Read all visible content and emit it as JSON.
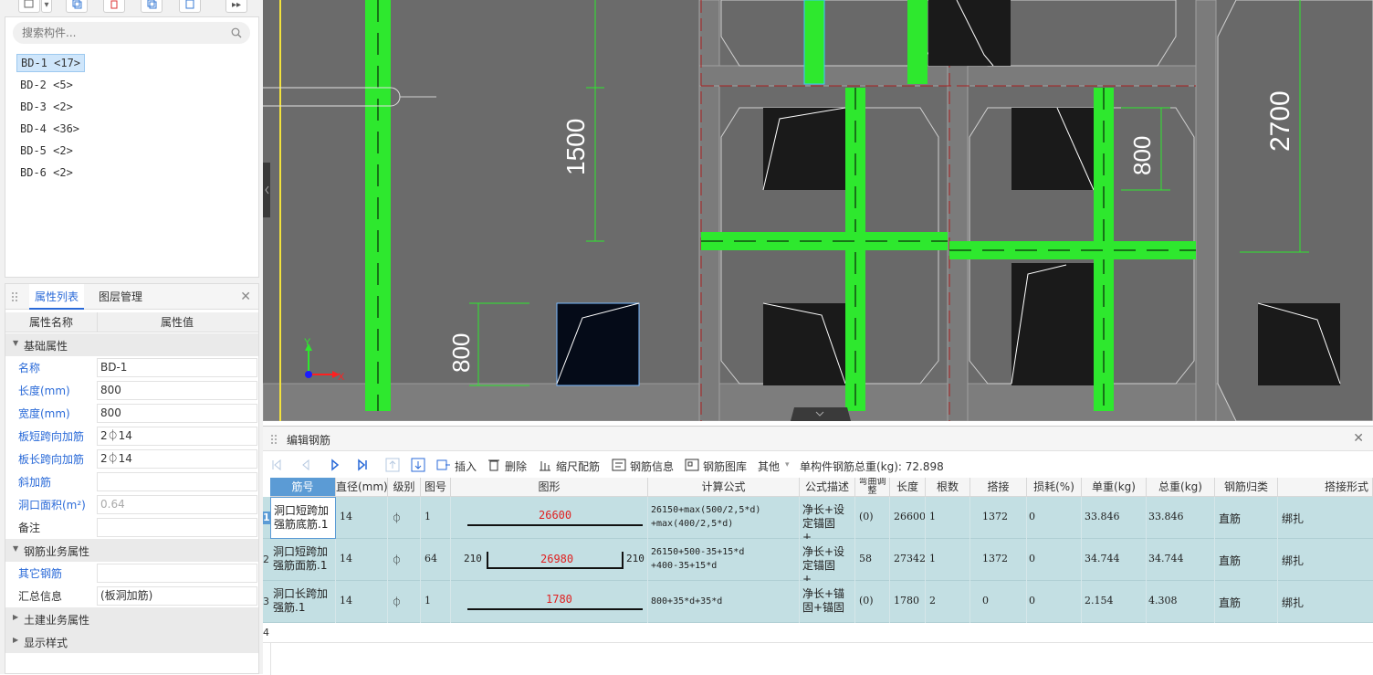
{
  "component_list": {
    "search_placeholder": "搜索构件...",
    "items": [
      {
        "label": "BD-1 <17>",
        "selected": true
      },
      {
        "label": "BD-2 <5>"
      },
      {
        "label": "BD-3 <2>"
      },
      {
        "label": "BD-4 <36>"
      },
      {
        "label": "BD-5 <2>"
      },
      {
        "label": "BD-6 <2>"
      }
    ]
  },
  "properties": {
    "tabs": [
      "属性列表",
      "图层管理"
    ],
    "header": {
      "name": "属性名称",
      "value": "属性值"
    },
    "groups": {
      "basic": "基础属性",
      "rebar_business": "钢筋业务属性",
      "civil_business": "土建业务属性",
      "display_style": "显示样式"
    },
    "rows": [
      {
        "name": "名称",
        "value": "BD-1"
      },
      {
        "name": "长度(mm)",
        "value": "800"
      },
      {
        "name": "宽度(mm)",
        "value": "800"
      },
      {
        "name": "板短跨向加筋",
        "value": "2⏀14"
      },
      {
        "name": "板长跨向加筋",
        "value": "2⏀14"
      },
      {
        "name": "斜加筋",
        "value": ""
      },
      {
        "name": "洞口面积(m²)",
        "value": "0.64"
      },
      {
        "name": "备注",
        "value": ""
      },
      {
        "name": "其它钢筋",
        "value": ""
      },
      {
        "name": "汇总信息",
        "value": "(板洞加筋)"
      }
    ]
  },
  "canvas": {
    "dimensions": [
      "1500",
      "800",
      "800",
      "2700"
    ],
    "axis_x": "X",
    "axis_y": "Y"
  },
  "editor": {
    "title": "编辑钢筋",
    "tools": {
      "insert": "插入",
      "delete": "删除",
      "scale": "缩尺配筋",
      "info": "钢筋信息",
      "library": "钢筋图库",
      "other": "其他",
      "total": "单构件钢筋总重(kg): 72.898"
    },
    "columns": [
      "筋号",
      "直径(mm)",
      "级别",
      "图号",
      "图形",
      "计算公式",
      "公式描述",
      "弯曲调整",
      "长度",
      "根数",
      "搭接",
      "损耗(%)",
      "单重(kg)",
      "总重(kg)",
      "钢筋归类",
      "搭接形式"
    ],
    "rows": [
      {
        "no": "1",
        "name": "洞口短跨加强筋底筋.1",
        "diameter": "14",
        "grade": "⏀",
        "shape_no": "1",
        "shape_value": "26600",
        "shape_left": "",
        "shape_right": "",
        "formula": "26150+max(500/2,5*d)\n+max(400/2,5*d)",
        "desc": "净长+设定锚固+…",
        "bend": "(0)",
        "length": "26600",
        "count": "1",
        "lap": "1372",
        "loss": "0",
        "unit_weight": "33.846",
        "total_weight": "33.846",
        "category": "直筋",
        "lap_type": "绑扎"
      },
      {
        "no": "2",
        "name": "洞口短跨加强筋面筋.1",
        "diameter": "14",
        "grade": "⏀",
        "shape_no": "64",
        "shape_value": "26980",
        "shape_left": "210",
        "shape_right": "210",
        "formula": "26150+500-35+15*d\n+400-35+15*d",
        "desc": "净长+设定锚固+…",
        "bend": "58",
        "length": "27342",
        "count": "1",
        "lap": "1372",
        "loss": "0",
        "unit_weight": "34.744",
        "total_weight": "34.744",
        "category": "直筋",
        "lap_type": "绑扎"
      },
      {
        "no": "3",
        "name": "洞口长跨加强筋.1",
        "diameter": "14",
        "grade": "⏀",
        "shape_no": "1",
        "shape_value": "1780",
        "shape_left": "",
        "shape_right": "",
        "formula": "800+35*d+35*d",
        "desc": "净长+锚固+锚固",
        "bend": "(0)",
        "length": "1780",
        "count": "2",
        "lap": "0",
        "loss": "0",
        "unit_weight": "2.154",
        "total_weight": "4.308",
        "category": "直筋",
        "lap_type": "绑扎"
      }
    ],
    "empty_row_no": "4"
  }
}
